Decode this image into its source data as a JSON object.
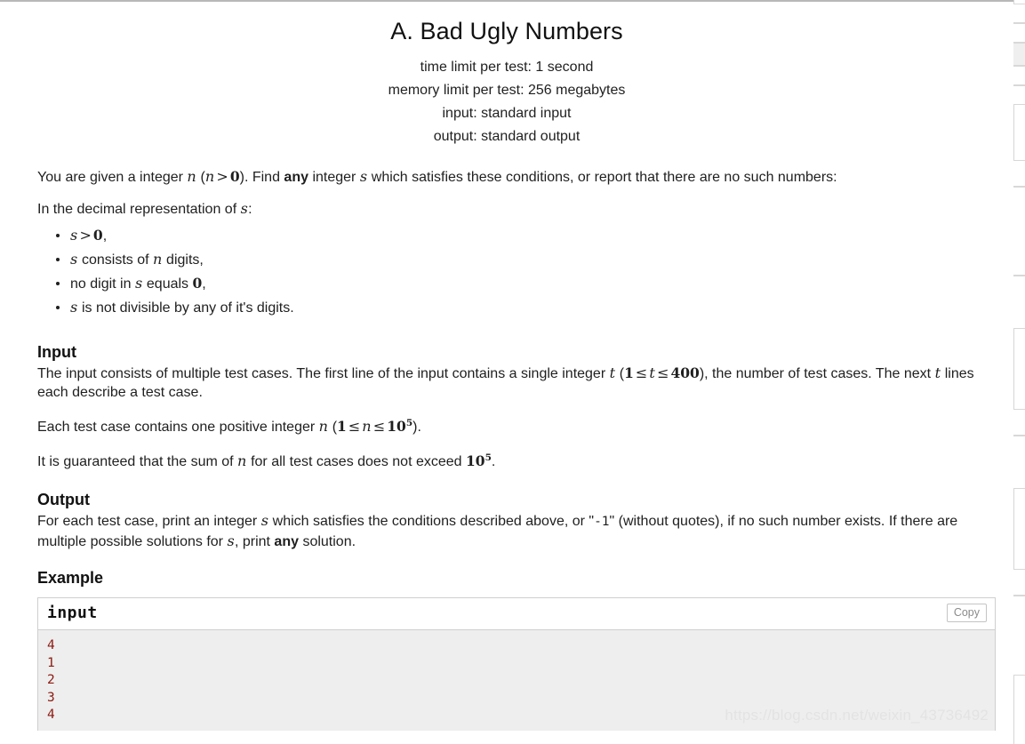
{
  "problem": {
    "title": "A. Bad Ugly Numbers",
    "limits": [
      "time limit per test: 1 second",
      "memory limit per test: 256 megabytes",
      "input: standard input",
      "output: standard output"
    ],
    "statement": {
      "lead_1": "You are given a integer ",
      "lead_var_n": "n",
      "lead_2": " (",
      "lead_n2": "n",
      "lead_gt": ">",
      "lead_zero": "0",
      "lead_3": "). Find ",
      "lead_any": "any",
      "lead_4": " integer ",
      "lead_var_s": "s",
      "lead_5": " which satisfies these conditions, or report that there are no such numbers:",
      "decimal_line_1": "In the decimal representation of ",
      "decimal_var_s": "s",
      "decimal_line_2": ":"
    },
    "conditions": [
      {
        "var": "s",
        "op": ">",
        "num": "0",
        "tail": ","
      },
      {
        "var": "s",
        "mid": " consists of ",
        "var2": "n",
        "tail": " digits,"
      },
      {
        "pre": "no digit in ",
        "var": "s",
        "mid": " equals ",
        "num": "0",
        "tail": ","
      },
      {
        "var": "s",
        "tail": " is not divisible by any of it's digits."
      }
    ],
    "input_section": {
      "title": "Input",
      "p1_a": "The input consists of multiple test cases. The first line of the input contains a single integer ",
      "p1_var_t": "t",
      "p1_b": " (",
      "p1_one": "1",
      "p1_le1": "≤",
      "p1_t2": "t",
      "p1_le2": "≤",
      "p1_max": "400",
      "p1_c": "), the number of test cases. The next ",
      "p1_var_t2": "t",
      "p1_d": " lines each describe a test case.",
      "p2_a": "Each test case contains one positive integer ",
      "p2_var_n": "n",
      "p2_b": " (",
      "p2_one": "1",
      "p2_le1": "≤",
      "p2_n2": "n",
      "p2_le2": "≤",
      "p2_base": "10",
      "p2_exp": "5",
      "p2_c": ").",
      "p3_a": "It is guaranteed that the sum of ",
      "p3_var_n": "n",
      "p3_b": " for all test cases does not exceed ",
      "p3_base": "10",
      "p3_exp": "5",
      "p3_c": "."
    },
    "output_section": {
      "title": "Output",
      "a": "For each test case, print an integer ",
      "var_s": "s",
      "b": " which satisfies the conditions described above, or \"",
      "mono_value": "-1",
      "c": "\" (without quotes), if no such number exists. If there are multiple possible solutions for ",
      "var_s2": "s",
      "d": ", print ",
      "any": "any",
      "e": " solution."
    },
    "example": {
      "title": "Example",
      "input_label": "input",
      "copy_label": "Copy",
      "input_lines": [
        "4",
        "1",
        "2",
        "3",
        "4"
      ]
    }
  },
  "watermark": "https://blog.csdn.net/weixin_43736492",
  "colors": {
    "sample_text": "#8b1a10",
    "sample_bg": "#eeeeee",
    "border": "#cfcfcf",
    "watermark": "#e3e3e3"
  }
}
